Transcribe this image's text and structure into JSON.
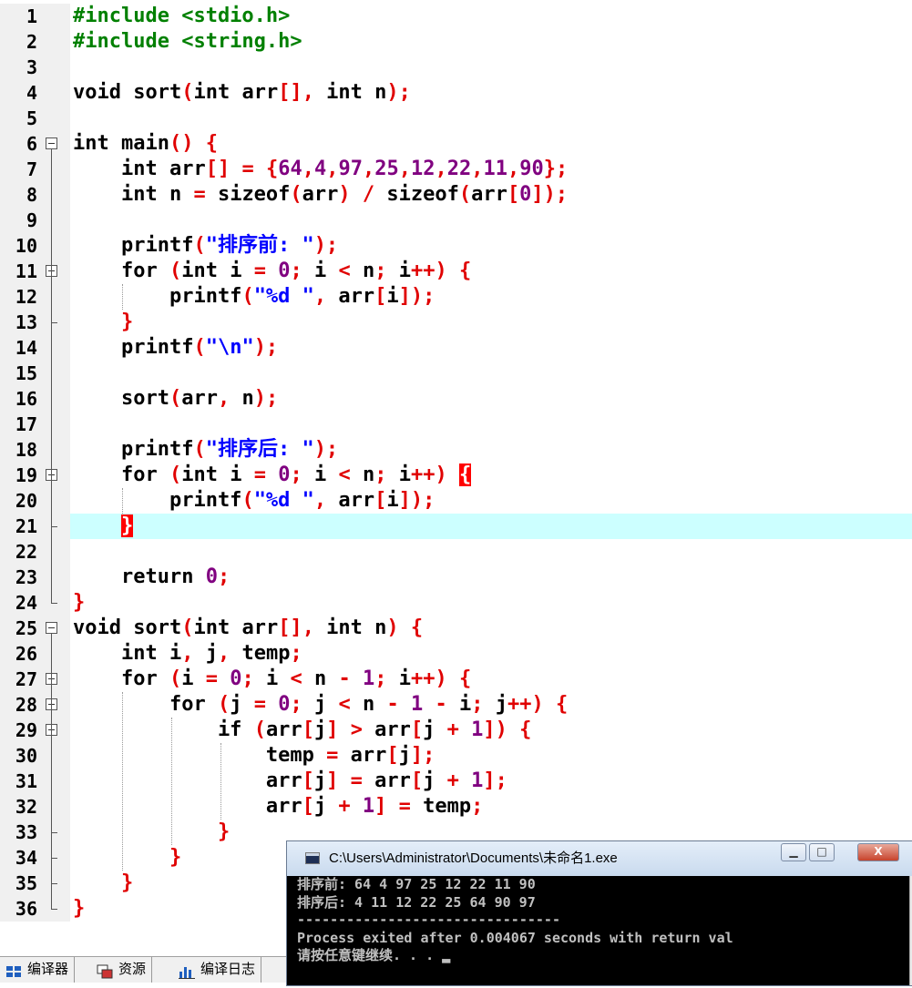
{
  "editor": {
    "lines": [
      {
        "n": "1",
        "code": "<span class=\"pp\">#include &lt;stdio.h&gt;</span>"
      },
      {
        "n": "2",
        "code": "<span class=\"pp\">#include &lt;string.h&gt;</span>"
      },
      {
        "n": "3",
        "code": ""
      },
      {
        "n": "4",
        "code": "void sort<span class=\"sy\">(</span>int arr<span class=\"sy\">[]</span><span class=\"sy\">,</span> int n<span class=\"sy\">);</span>"
      },
      {
        "n": "5",
        "code": ""
      },
      {
        "n": "6",
        "code": "int main<span class=\"sy\">()</span> <span class=\"sy\">{</span>"
      },
      {
        "n": "7",
        "code": "    int arr<span class=\"sy\">[]</span> <span class=\"sy\">=</span> <span class=\"sy\">{</span><span class=\"nm\">64</span><span class=\"sy\">,</span><span class=\"nm\">4</span><span class=\"sy\">,</span><span class=\"nm\">97</span><span class=\"sy\">,</span><span class=\"nm\">25</span><span class=\"sy\">,</span><span class=\"nm\">12</span><span class=\"sy\">,</span><span class=\"nm\">22</span><span class=\"sy\">,</span><span class=\"nm\">11</span><span class=\"sy\">,</span><span class=\"nm\">90</span><span class=\"sy\">};</span>"
      },
      {
        "n": "8",
        "code": "    int n <span class=\"sy\">=</span> sizeof<span class=\"sy\">(</span>arr<span class=\"sy\">)</span> <span class=\"sy\">/</span> sizeof<span class=\"sy\">(</span>arr<span class=\"sy\">[</span><span class=\"nm\">0</span><span class=\"sy\">]);</span>"
      },
      {
        "n": "9",
        "code": ""
      },
      {
        "n": "10",
        "code": "    printf<span class=\"sy\">(</span><span class=\"st\">\"排序前: \"</span><span class=\"sy\">);</span>"
      },
      {
        "n": "11",
        "code": "    for <span class=\"sy\">(</span>int i <span class=\"sy\">=</span> <span class=\"nm\">0</span><span class=\"sy\">;</span> i <span class=\"sy\">&lt;</span> n<span class=\"sy\">;</span> i<span class=\"sy\">++)</span> <span class=\"sy\">{</span>"
      },
      {
        "n": "12",
        "code": "        printf<span class=\"sy\">(</span><span class=\"st\">\"%d \"</span><span class=\"sy\">,</span> arr<span class=\"sy\">[</span>i<span class=\"sy\">]);</span>"
      },
      {
        "n": "13",
        "code": "    <span class=\"sy\">}</span>"
      },
      {
        "n": "14",
        "code": "    printf<span class=\"sy\">(</span><span class=\"st\">\"\\n\"</span><span class=\"sy\">);</span>"
      },
      {
        "n": "15",
        "code": ""
      },
      {
        "n": "16",
        "code": "    sort<span class=\"sy\">(</span>arr<span class=\"sy\">,</span> n<span class=\"sy\">);</span>"
      },
      {
        "n": "17",
        "code": ""
      },
      {
        "n": "18",
        "code": "    printf<span class=\"sy\">(</span><span class=\"st\">\"排序后: \"</span><span class=\"sy\">);</span>"
      },
      {
        "n": "19",
        "code": "    for <span class=\"sy\">(</span>int i <span class=\"sy\">=</span> <span class=\"nm\">0</span><span class=\"sy\">;</span> i <span class=\"sy\">&lt;</span> n<span class=\"sy\">;</span> i<span class=\"sy\">++)</span> <span class=\"cur\">{</span>"
      },
      {
        "n": "20",
        "code": "        printf<span class=\"sy\">(</span><span class=\"st\">\"%d \"</span><span class=\"sy\">,</span> arr<span class=\"sy\">[</span>i<span class=\"sy\">]);</span>"
      },
      {
        "n": "21",
        "code": "    <span class=\"cur\">}</span>",
        "active": true
      },
      {
        "n": "22",
        "code": ""
      },
      {
        "n": "23",
        "code": "    return <span class=\"nm\">0</span><span class=\"sy\">;</span>"
      },
      {
        "n": "24",
        "code": "<span class=\"sy\">}</span>"
      },
      {
        "n": "25",
        "code": "void sort<span class=\"sy\">(</span>int arr<span class=\"sy\">[]</span><span class=\"sy\">,</span> int n<span class=\"sy\">)</span> <span class=\"sy\">{</span>"
      },
      {
        "n": "26",
        "code": "    int i<span class=\"sy\">,</span> j<span class=\"sy\">,</span> temp<span class=\"sy\">;</span>"
      },
      {
        "n": "27",
        "code": "    for <span class=\"sy\">(</span>i <span class=\"sy\">=</span> <span class=\"nm\">0</span><span class=\"sy\">;</span> i <span class=\"sy\">&lt;</span> n <span class=\"sy\">-</span> <span class=\"nm\">1</span><span class=\"sy\">;</span> i<span class=\"sy\">++)</span> <span class=\"sy\">{</span>"
      },
      {
        "n": "28",
        "code": "        for <span class=\"sy\">(</span>j <span class=\"sy\">=</span> <span class=\"nm\">0</span><span class=\"sy\">;</span> j <span class=\"sy\">&lt;</span> n <span class=\"sy\">-</span> <span class=\"nm\">1</span> <span class=\"sy\">-</span> i<span class=\"sy\">;</span> j<span class=\"sy\">++)</span> <span class=\"sy\">{</span>"
      },
      {
        "n": "29",
        "code": "            if <span class=\"sy\">(</span>arr<span class=\"sy\">[</span>j<span class=\"sy\">]</span> <span class=\"sy\">&gt;</span> arr<span class=\"sy\">[</span>j <span class=\"sy\">+</span> <span class=\"nm\">1</span><span class=\"sy\">])</span> <span class=\"sy\">{</span>"
      },
      {
        "n": "30",
        "code": "                temp <span class=\"sy\">=</span> arr<span class=\"sy\">[</span>j<span class=\"sy\">];</span>"
      },
      {
        "n": "31",
        "code": "                arr<span class=\"sy\">[</span>j<span class=\"sy\">]</span> <span class=\"sy\">=</span> arr<span class=\"sy\">[</span>j <span class=\"sy\">+</span> <span class=\"nm\">1</span><span class=\"sy\">];</span>"
      },
      {
        "n": "32",
        "code": "                arr<span class=\"sy\">[</span>j <span class=\"sy\">+</span> <span class=\"nm\">1</span><span class=\"sy\">]</span> <span class=\"sy\">=</span> temp<span class=\"sy\">;</span>"
      },
      {
        "n": "33",
        "code": "            <span class=\"sy\">}</span>"
      },
      {
        "n": "34",
        "code": "        <span class=\"sy\">}</span>"
      },
      {
        "n": "35",
        "code": "    <span class=\"sy\">}</span>"
      },
      {
        "n": "36",
        "code": "<span class=\"sy\">}</span>"
      }
    ]
  },
  "console": {
    "title": "C:\\Users\\Administrator\\Documents\\未命名1.exe",
    "minimize_glyph": "▁",
    "maximize_glyph": "□",
    "close_glyph": "X",
    "output": [
      "排序前: 64 4 97 25 12 22 11 90",
      "排序后: 4 11 12 22 25 64 90 97",
      "--------------------------------",
      "Process exited after 0.004067 seconds with return val",
      "请按任意键继续. . . ▂"
    ]
  },
  "bottom_tabs": [
    {
      "label": "编译器",
      "icon": "compiler-icon"
    },
    {
      "label": "资源",
      "icon": "resources-icon"
    },
    {
      "label": "编译日志",
      "icon": "compile-log-icon"
    }
  ],
  "colors": {
    "active_line": "#ccffff",
    "preprocessor": "#008000",
    "symbol": "#e00000",
    "number": "#800080",
    "string": "#0000ff"
  }
}
